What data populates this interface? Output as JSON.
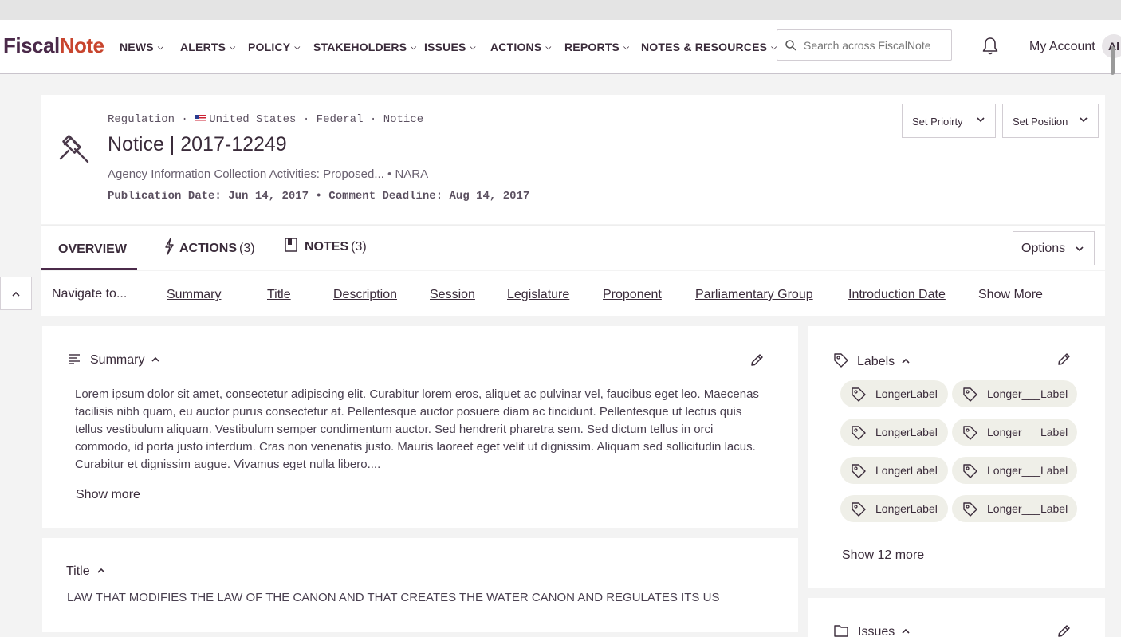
{
  "nav": {
    "logo_part1": "Fiscal",
    "logo_part2": "Note",
    "items": [
      "NEWS",
      "ALERTS",
      "POLICY",
      "STAKEHOLDERS",
      "ISSUES",
      "ACTIONS",
      "REPORTS",
      "NOTES & RESOURCES"
    ],
    "search_placeholder": "Search across FiscalNote",
    "account_label": "My Account",
    "avatar_initials": "Al"
  },
  "document": {
    "type": "Regulation",
    "country": "United States",
    "level": "Federal",
    "kind": "Notice",
    "title": "Notice | 2017-12249",
    "subtitle_text": "Agency Information Collection Activities: Proposed...",
    "agency": "NARA",
    "publication_date_label": "Publication Date:",
    "publication_date": "Jun 14, 2017",
    "comment_deadline_label": "Comment Deadline:",
    "comment_deadline": "Aug 14, 2017",
    "set_priority_label": "Set Prioirty",
    "set_position_label": "Set Position"
  },
  "tabs": {
    "overview": "OVERVIEW",
    "actions": "ACTIONS",
    "actions_count": "(3)",
    "notes": "NOTES",
    "notes_count": "(3)",
    "options_label": "Options"
  },
  "navigate": {
    "label": "Navigate to...",
    "links": [
      "Summary",
      "Title",
      "Description",
      "Session",
      "Legislature",
      "Proponent",
      "Parliamentary Group",
      "Introduction Date"
    ],
    "show_more": "Show More"
  },
  "summary": {
    "heading": "Summary",
    "text": "Lorem ipsum dolor sit amet, consectetur adipiscing elit. Curabitur lorem eros, aliquet ac pulvinar vel, faucibus eget leo. Maecenas facilisis nibh quam, eu auctor purus consectetur at. Pellentesque auctor posuere diam ac tincidunt. Pellentesque ut lectus quis tellus vestibulum aliquam. Vestibulum semper condimentum auctor. Sed hendrerit pharetra sem. Sed dictum tellus in orci commodo, id porta justo interdum. Cras non venenatis justo. Mauris laoreet eget velit ut dignissim. Aliquam sed sollicitudin lacus. Curabitur et dignissim augue. Vivamus eget nulla libero....",
    "show_more": "Show more"
  },
  "title_section": {
    "heading": "Title",
    "text": "LAW THAT MODIFIES THE LAW OF THE CANON AND THAT CREATES THE WATER CANON AND REGULATES ITS US"
  },
  "labels": {
    "heading": "Labels",
    "items": [
      "LongerLabel",
      "Longer___Label",
      "LongerLabel",
      "Longer___Label",
      "LongerLabel",
      "Longer___Label",
      "LongerLabel",
      "Longer___Label"
    ],
    "show_more": "Show 12 more"
  },
  "issues": {
    "heading": "Issues"
  },
  "colors": {
    "brand_dark": "#4b2a4a",
    "brand_accent": "#c8452e",
    "chip_bg": "#efefe8"
  }
}
